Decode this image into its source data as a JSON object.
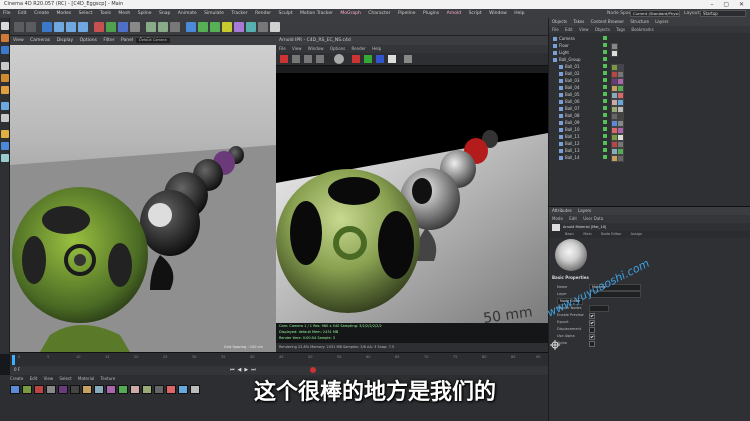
{
  "window": {
    "title": "Cinema 4D R20.057 (RC) - [C4D_Eggscp] - Main",
    "controls": "–  ▢  ✕"
  },
  "menubar": {
    "items": [
      "File",
      "Edit",
      "Create",
      "Modes",
      "Select",
      "Tools",
      "Mesh",
      "Spline",
      "Snap",
      "Animate",
      "Simulate",
      "Tracker",
      "Render",
      "Sculpt",
      "Motion Tracker",
      "MoGraph",
      "Character",
      "Pipeline",
      "Plugins",
      "Arnold",
      "Script",
      "Window",
      "Help"
    ],
    "layout_label": "Node Space:",
    "layout_value": "Current (Standard/Physical)",
    "layout_right": "Layout:",
    "layout_right_value": "Startup"
  },
  "viewport": {
    "menu": [
      "View",
      "Cameras",
      "Display",
      "Options",
      "Filter",
      "Panel",
      "ProRender"
    ],
    "camera": "Default Camera",
    "status": "Grid Spacing : 100 cm"
  },
  "render_view": {
    "title": "Arnold IPR - C4D_RS_EC_NS.c4d",
    "menu": [
      "File",
      "View",
      "Window",
      "Options",
      "Render",
      "Help"
    ],
    "info_lines": [
      "Cam: Camera  1 / 1  Res: 960 x 540  Sampling: 3/2/2/2/2/2/2",
      "Displayed: default  Mem: 2431 MB",
      "Render time: 0:00:04  Sample: 3"
    ],
    "status": "Rendering  22.8%  Memory: 2431 MB  Samples: 3/6  AA: 3  Snap: 7.5"
  },
  "timeline": {
    "ticks": [
      "0",
      "5",
      "10",
      "15",
      "20",
      "25",
      "30",
      "35",
      "40",
      "45",
      "50",
      "55",
      "60",
      "65",
      "70",
      "75",
      "80",
      "85",
      "90"
    ],
    "frame": "0 F"
  },
  "material_manager": {
    "menu": [
      "Create",
      "Edit",
      "View",
      "Select",
      "Material",
      "Texture"
    ]
  },
  "object_manager": {
    "tabs": [
      "Objects",
      "Takes",
      "Content Browser",
      "Structure",
      "Layers"
    ],
    "menu": [
      "File",
      "Edit",
      "View",
      "Objects",
      "Tags",
      "Bookmarks"
    ],
    "rows": [
      "Camera",
      "Floor",
      "Light",
      "Ball_Group",
      "Ball_01",
      "Ball_02",
      "Ball_03",
      "Ball_04",
      "Ball_05",
      "Ball_06",
      "Ball_07",
      "Ball_08",
      "Ball_09",
      "Ball_10",
      "Ball_11",
      "Ball_12",
      "Ball_13",
      "Ball_14"
    ]
  },
  "attribute_manager": {
    "tabs": [
      "Attributes",
      "Layers"
    ],
    "menu": [
      "Mode",
      "Edit",
      "User Data"
    ],
    "mode_title": "Arnold Material [Mat_16]",
    "subtabs": [
      "Basic",
      "Main",
      "Node Editor",
      "Assign"
    ],
    "section": "Basic Properties",
    "fields": [
      {
        "label": "Name",
        "value": "Material"
      },
      {
        "label": "Layer",
        "value": ""
      },
      {
        "label": "Node Editor",
        "value": "Node Editor"
      },
      {
        "label": "Render Nodes",
        "value": ""
      }
    ],
    "checks": [
      {
        "label": "Enable Preview",
        "checked": true
      },
      {
        "label": "Export",
        "checked": true
      },
      {
        "label": "Displacement",
        "checked": false
      },
      {
        "label": "Use Alpha",
        "checked": true
      },
      {
        "label": "Alpha",
        "checked": false
      }
    ]
  },
  "subtitle": "这个很棒的地方是我们的",
  "watermark": "www.yuyuaoshi.com"
}
